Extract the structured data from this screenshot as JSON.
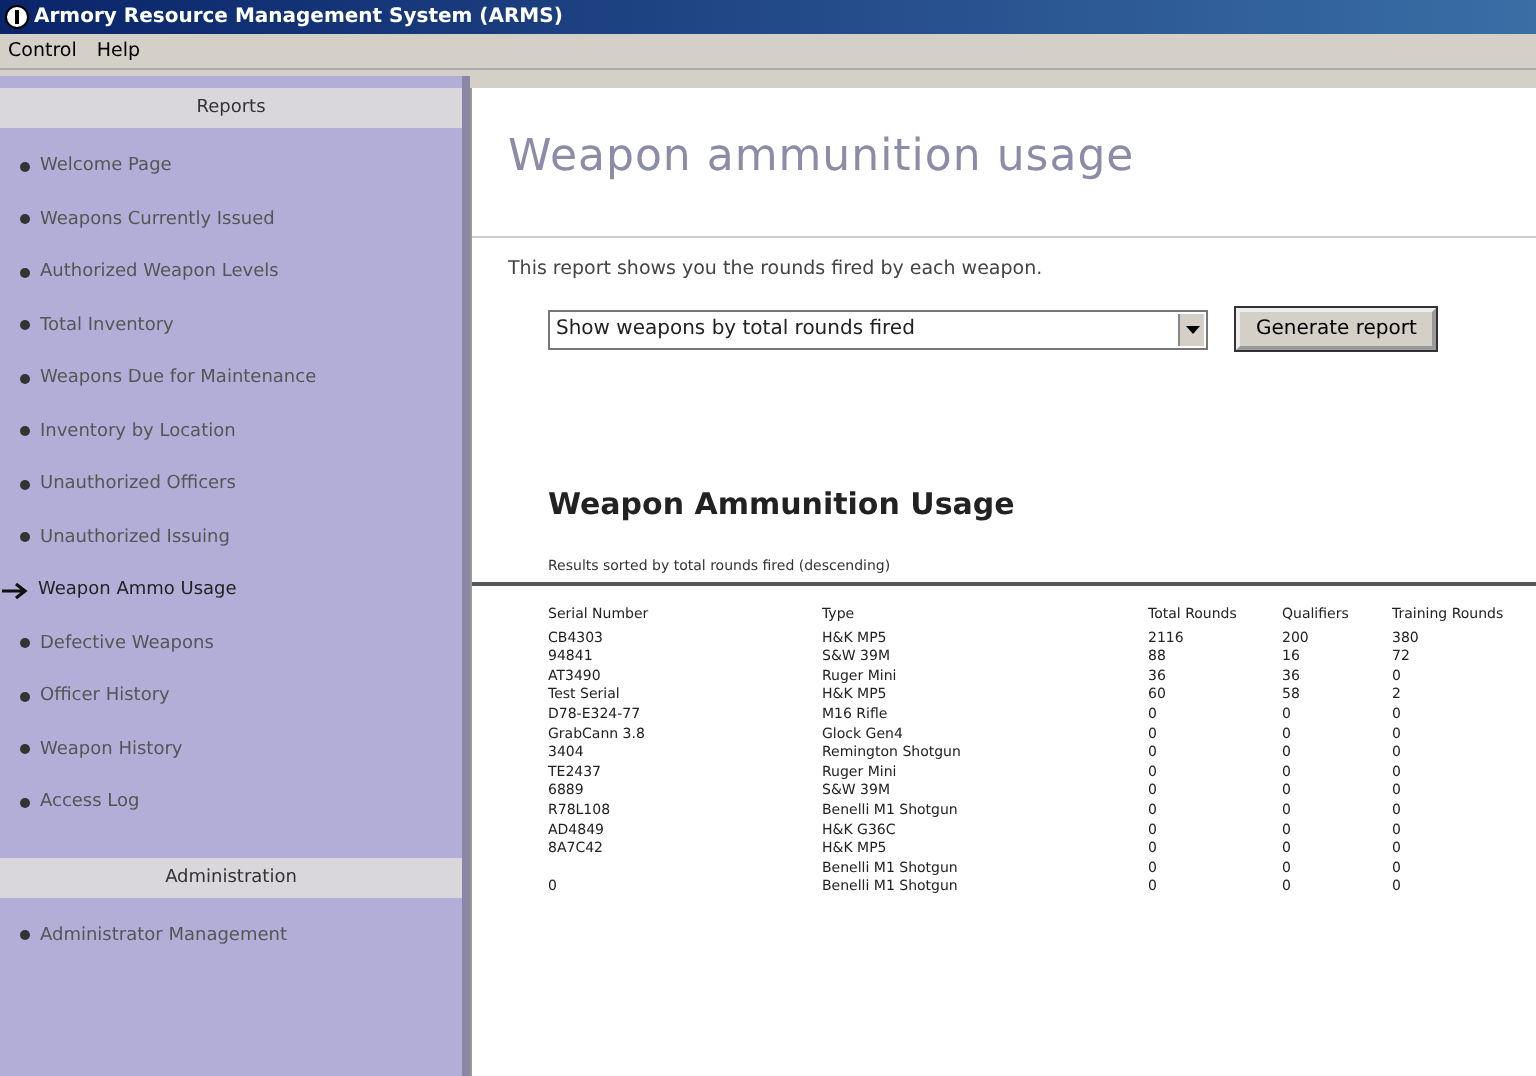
{
  "window": {
    "title": "Armory Resource Management System (ARMS)"
  },
  "menu": [
    "Control",
    "Help"
  ],
  "sidebar": {
    "sections": [
      {
        "title": "Reports",
        "items": [
          {
            "label": "Welcome Page",
            "selected": false
          },
          {
            "label": "Weapons Currently Issued",
            "selected": false
          },
          {
            "label": "Authorized Weapon Levels",
            "selected": false
          },
          {
            "label": "Total Inventory",
            "selected": false
          },
          {
            "label": "Weapons Due for Maintenance",
            "selected": false
          },
          {
            "label": "Inventory by Location",
            "selected": false
          },
          {
            "label": "Unauthorized Officers",
            "selected": false
          },
          {
            "label": "Unauthorized Issuing",
            "selected": false
          },
          {
            "label": "Weapon Ammo Usage",
            "selected": true
          },
          {
            "label": "Defective Weapons",
            "selected": false
          },
          {
            "label": "Officer History",
            "selected": false
          },
          {
            "label": "Weapon History",
            "selected": false
          },
          {
            "label": "Access Log",
            "selected": false
          }
        ]
      },
      {
        "title": "Administration",
        "items": [
          {
            "label": "Administrator Management",
            "selected": false
          }
        ]
      }
    ]
  },
  "page": {
    "title": "Weapon ammunition usage",
    "description": "This report shows you the rounds fired by each weapon.",
    "sort_select": {
      "value": "Show weapons by total rounds fired"
    },
    "generate_button": "Generate report"
  },
  "report": {
    "title": "Weapon Ammunition Usage",
    "subtitle": "Results sorted by total rounds fired (descending)",
    "columns": [
      "Serial Number",
      "Type",
      "Total Rounds",
      "Qualifiers",
      "Training Rounds"
    ],
    "rows": [
      [
        "CB4303",
        "H&K MP5",
        "2116",
        "200",
        "380"
      ],
      [
        "94841",
        "S&W 39M",
        "88",
        "16",
        "72"
      ],
      [
        "AT3490",
        "Ruger Mini",
        "36",
        "36",
        "0"
      ],
      [
        "Test Serial",
        "H&K MP5",
        "60",
        "58",
        "2"
      ],
      [
        "D78-E324-77",
        "M16 Rifle",
        "0",
        "0",
        "0"
      ],
      [
        "GrabCann 3.8",
        "Glock Gen4",
        "0",
        "0",
        "0"
      ],
      [
        "3404",
        "Remington Shotgun",
        "0",
        "0",
        "0"
      ],
      [
        "TE2437",
        "Ruger Mini",
        "0",
        "0",
        "0"
      ],
      [
        "6889",
        "S&W 39M",
        "0",
        "0",
        "0"
      ],
      [
        "R78L108",
        "Benelli M1 Shotgun",
        "0",
        "0",
        "0"
      ],
      [
        "AD4849",
        "H&K G36C",
        "0",
        "0",
        "0"
      ],
      [
        "8A7C42",
        "H&K MP5",
        "0",
        "0",
        "0"
      ],
      [
        "",
        "Benelli M1 Shotgun",
        "0",
        "0",
        "0"
      ],
      [
        "0",
        "Benelli M1 Shotgun",
        "0",
        "0",
        "0"
      ]
    ]
  }
}
